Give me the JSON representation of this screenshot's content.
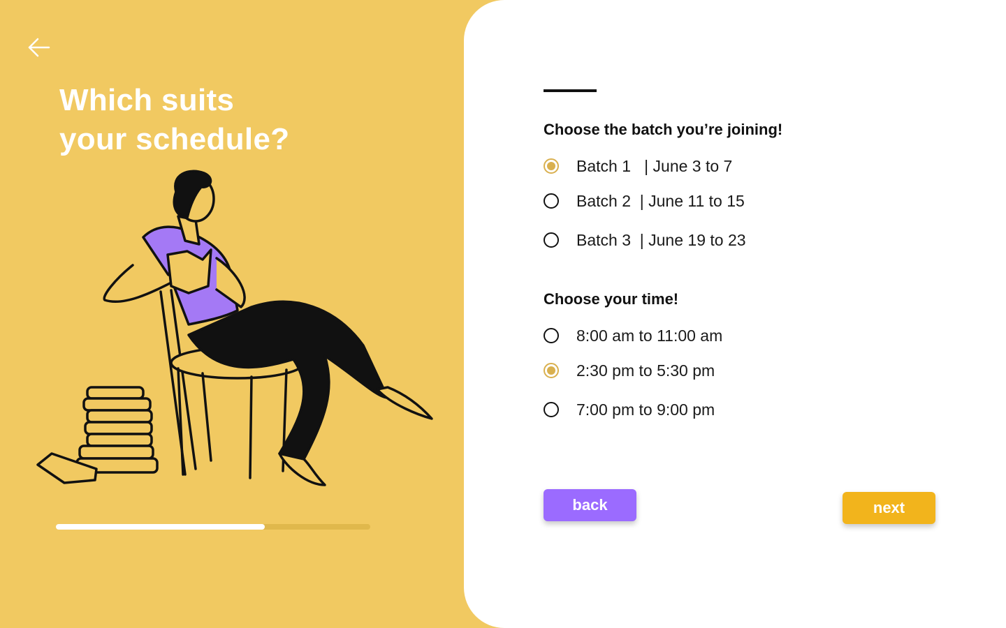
{
  "intro": {
    "headline_line1": "Which suits",
    "headline_line2": "your schedule?"
  },
  "progress": {
    "value": 0.665
  },
  "batch_section": {
    "title": "Choose the batch you’re joining!",
    "options": [
      {
        "label": "Batch 1   | June 3 to 7",
        "selected": true
      },
      {
        "label": "Batch 2  | June 11 to 15",
        "selected": false
      },
      {
        "label": "Batch 3  | June 19 to 23",
        "selected": false
      }
    ]
  },
  "time_section": {
    "title": "Choose your time!",
    "options": [
      {
        "label": "8:00 am to 11:00 am",
        "selected": false
      },
      {
        "label": "2:30 pm to 5:30 pm",
        "selected": true
      },
      {
        "label": "7:00 pm to 9:00 pm",
        "selected": false
      }
    ]
  },
  "buttons": {
    "back_label": "back",
    "next_label": "next"
  },
  "colors": {
    "panel_yellow": "#f1c961",
    "radio_accent": "#d9b04f",
    "back_button": "#9b6bff",
    "next_button": "#f2b41c",
    "shirt_purple": "#a479f5"
  },
  "icons": {
    "back": "arrow-left-icon"
  }
}
